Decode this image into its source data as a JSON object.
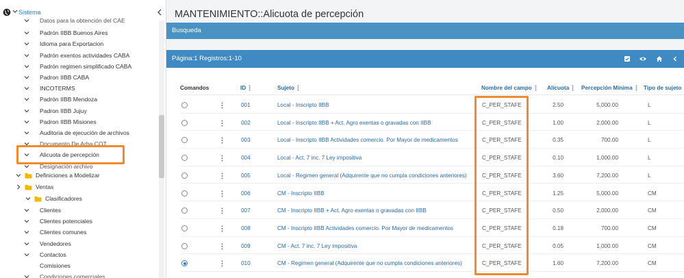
{
  "sidebar": {
    "title": "Sistema",
    "items": [
      {
        "label": "Datos para la obtención del CAE",
        "clip": true
      },
      {
        "label": "Padrón IIBB Buenos Aires"
      },
      {
        "label": "Idioma para Exportacion"
      },
      {
        "label": "Padrón exentos actividades CABA"
      },
      {
        "label": "Padrón regimen simplificado CABA"
      },
      {
        "label": "Padron IIBB CABA"
      },
      {
        "label": "INCOTERMS"
      },
      {
        "label": "Padrón IIBB Mendoza"
      },
      {
        "label": "Padron IIBB Jujuy"
      },
      {
        "label": "Padron IIBB Misiones"
      },
      {
        "label": "Auditoria de ejecución de archivos"
      },
      {
        "label": "Documento De Arba COT",
        "clip": true
      },
      {
        "label": "Alicuota de percepción",
        "active": true
      },
      {
        "label": "Designación archivo",
        "clip": true
      }
    ],
    "groups": [
      {
        "label": "Definiciones a Modelizar"
      },
      {
        "label": "Ventas"
      },
      {
        "label": "Clasificadores"
      }
    ],
    "ventas_items": [
      {
        "label": "Clientes"
      },
      {
        "label": "Clientes potenciales"
      },
      {
        "label": "Clientes comunes"
      },
      {
        "label": "Vendedores"
      },
      {
        "label": "Contactos"
      },
      {
        "label": "Comisiones"
      },
      {
        "label": "Condiciones comerciales"
      }
    ]
  },
  "main": {
    "title": "MANTENIMIENTO::Alicuota de percepción",
    "search_bar": "Busqueda",
    "paging": "Página:1 Registros:1-10",
    "icons": [
      "checkbox-icon",
      "eye-icon",
      "home-icon",
      "chevron-left-icon"
    ],
    "columns": {
      "comandos": "Comandos",
      "id": "ID",
      "sujeto": "Sujeto",
      "campo": "Nombre del campo",
      "alicuota": "Alicuota",
      "minima": "Percepción Mínima",
      "tipo": "Tipo de sujeto"
    },
    "rows": [
      {
        "id": "001",
        "sujeto": "Local - Inscripto IIBB",
        "campo": "C_PER_STAFE",
        "alicuota": "2.50",
        "minima": "5,000.00",
        "tipo": "L",
        "selected": false
      },
      {
        "id": "002",
        "sujeto": "Local - Inscripto IIBB + Act. Agro exentas o gravadas con IIBB",
        "campo": "C_PER_STAFE",
        "alicuota": "1.00",
        "minima": "2,000.00",
        "tipo": "L",
        "selected": false
      },
      {
        "id": "003",
        "sujeto": "Local - Inscripto IIBB Actividades comercio. Por Mayor de medicamentos",
        "campo": "C_PER_STAFE",
        "alicuota": "0.35",
        "minima": "700.00",
        "tipo": "L",
        "selected": false
      },
      {
        "id": "004",
        "sujeto": "Local - Act. 7 inc. 7 Ley impositiva",
        "campo": "C_PER_STAFE",
        "alicuota": "0.10",
        "minima": "1,000.00",
        "tipo": "L",
        "selected": false
      },
      {
        "id": "005",
        "sujeto": "Local - Regimen general (Adquirente que no cumpla condiciones anteriores)",
        "campo": "C_PER_STAFE",
        "alicuota": "3.60",
        "minima": "7,200.00",
        "tipo": "L",
        "selected": false
      },
      {
        "id": "006",
        "sujeto": "CM - Inscripto IIBB",
        "campo": "C_PER_STAFE",
        "alicuota": "1.25",
        "minima": "5,000.00",
        "tipo": "CM",
        "selected": false
      },
      {
        "id": "007",
        "sujeto": "CM - Inscripto IIBB + Act. Agro exentas o gravadas con IIBB",
        "campo": "C_PER_STAFE",
        "alicuota": "0.50",
        "minima": "2,000.00",
        "tipo": "CM",
        "selected": false
      },
      {
        "id": "008",
        "sujeto": "CM - Inscripto IIBB Actividades comercio. Por Mayor de medicamentos",
        "campo": "C_PER_STAFE",
        "alicuota": "0.18",
        "minima": "700.00",
        "tipo": "CM",
        "selected": false
      },
      {
        "id": "009",
        "sujeto": "CM - Act. 7 inc. 7 Ley impositiva",
        "campo": "C_PER_STAFE",
        "alicuota": "0.05",
        "minima": "1,000.00",
        "tipo": "CM",
        "selected": false
      },
      {
        "id": "010",
        "sujeto": "CM - Regimen general (Adquirente que no cumpla condiciones anteriores)",
        "campo": "C_PER_STAFE",
        "alicuota": "1.60",
        "minima": "7,200.00",
        "tipo": "CM",
        "selected": true
      }
    ]
  },
  "colors": {
    "accent": "#3f8ac2",
    "link": "#2a6aa8",
    "highlight": "#f08a2c"
  }
}
